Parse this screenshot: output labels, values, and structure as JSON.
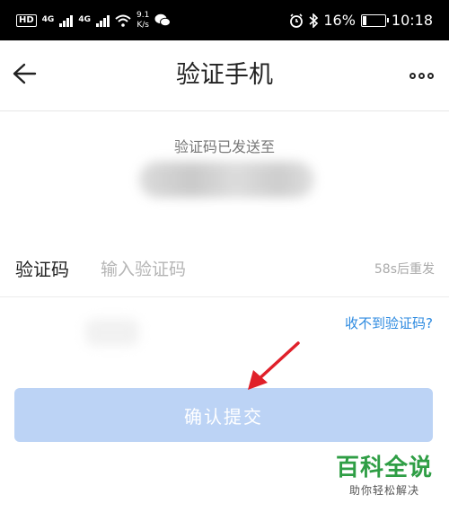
{
  "status_bar": {
    "network_label": "HD",
    "network_types": [
      "4G",
      "4G"
    ],
    "speed_value": "9.1",
    "speed_unit": "K/s",
    "battery": "16%",
    "battery_level": 0.16,
    "time": "10:18"
  },
  "header": {
    "title": "验证手机"
  },
  "main": {
    "sent_label": "验证码已发送至",
    "code_label": "验证码",
    "code_placeholder": "输入验证码",
    "resend_countdown": "58s后重发",
    "no_code_link": "收不到验证码?",
    "submit_label": "确认提交"
  },
  "watermark": {
    "main": "百科全说",
    "sub": "助你轻松解决"
  },
  "colors": {
    "link": "#2d8ae0",
    "button_disabled_bg": "#bcd3f5",
    "annotation_arrow": "#e0202a",
    "watermark_green": "#2f9e45"
  }
}
